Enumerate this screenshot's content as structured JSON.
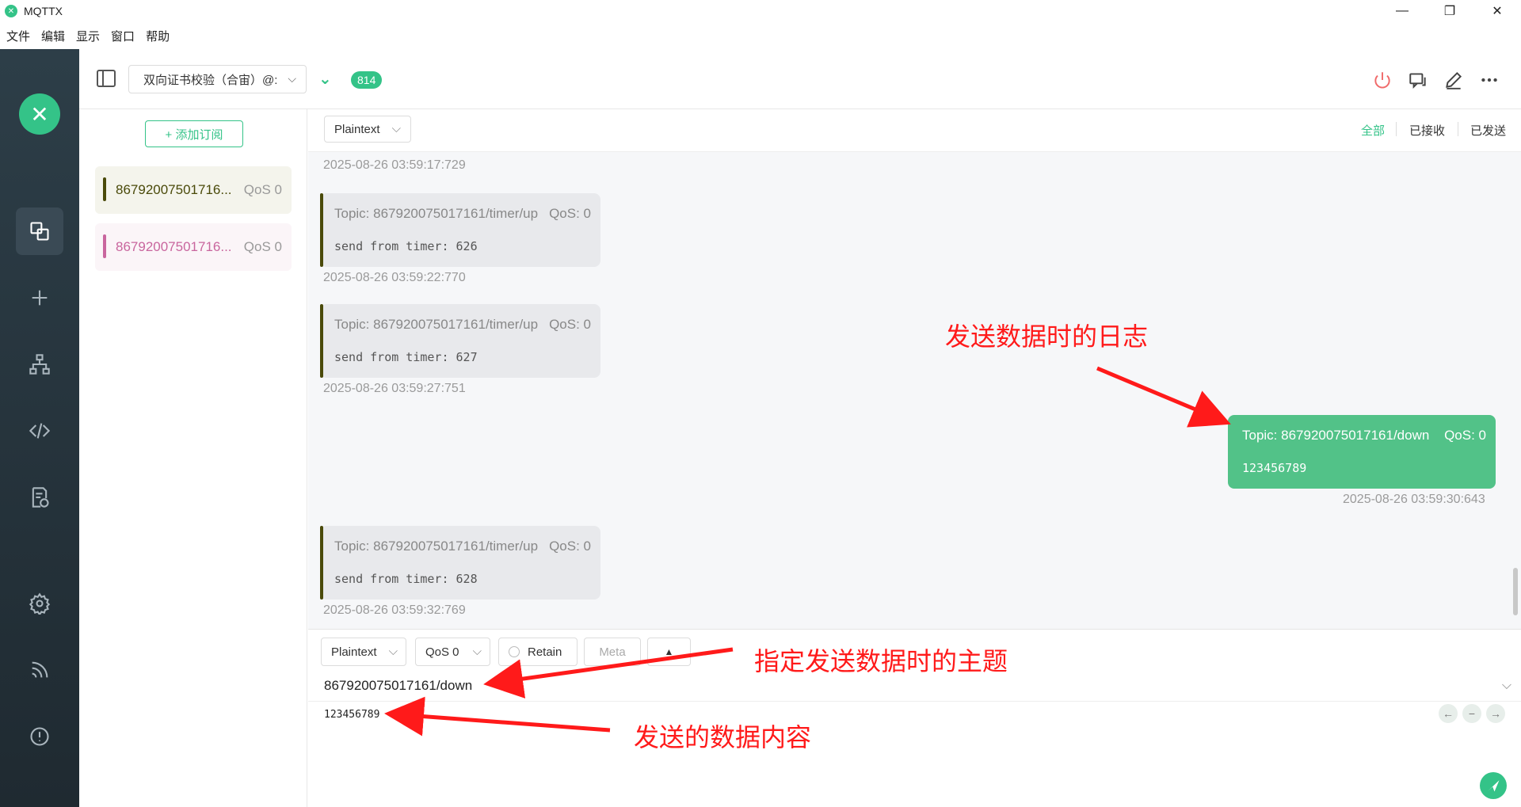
{
  "window": {
    "title": "MQTTX",
    "minimize_glyph": "—",
    "maximize_glyph": "❐",
    "close_glyph": "✕"
  },
  "menu": [
    "文件",
    "编辑",
    "显示",
    "窗口",
    "帮助"
  ],
  "header": {
    "connection_name": "双向证书校验（合宙）@:",
    "message_count": "814"
  },
  "subscriptions": {
    "add_label": "+ 添加订阅",
    "items": [
      {
        "topic": "86792007501716...",
        "qos": "QoS 0",
        "color": "#4a4a0a"
      },
      {
        "topic": "86792007501716...",
        "qos": "QoS 0",
        "color": "#c9669e"
      }
    ]
  },
  "message_toolbar": {
    "payload_format": "Plaintext",
    "filters": [
      "全部",
      "已接收",
      "已发送"
    ]
  },
  "messages": [
    {
      "type": "timestamp",
      "text": "2025-08-26 03:59:17:729"
    },
    {
      "type": "received",
      "topic": "Topic: 867920075017161/timer/up",
      "qos": "QoS: 0",
      "payload": "send from timer: 626",
      "time": "2025-08-26 03:59:22:770"
    },
    {
      "type": "received",
      "topic": "Topic: 867920075017161/timer/up",
      "qos": "QoS: 0",
      "payload": "send from timer: 627",
      "time": "2025-08-26 03:59:27:751"
    },
    {
      "type": "sent",
      "topic": "Topic: 867920075017161/down",
      "qos": "QoS: 0",
      "payload": "123456789",
      "time": "2025-08-26 03:59:30:643"
    },
    {
      "type": "received",
      "topic": "Topic: 867920075017161/timer/up",
      "qos": "QoS: 0",
      "payload": "send from timer: 628",
      "time": "2025-08-26 03:59:32:769"
    }
  ],
  "publish": {
    "payload_format": "Plaintext",
    "qos": "QoS 0",
    "retain_label": "Retain",
    "meta_label": "Meta",
    "topic": "867920075017161/down",
    "payload": "123456789"
  },
  "annotations": {
    "log": "发送数据时的日志",
    "topic": "指定发送数据时的主题",
    "payload": "发送的数据内容",
    "color": "#ff1a1a"
  },
  "colors": {
    "accent": "#34c388",
    "sidebar": "#2d3e48"
  }
}
